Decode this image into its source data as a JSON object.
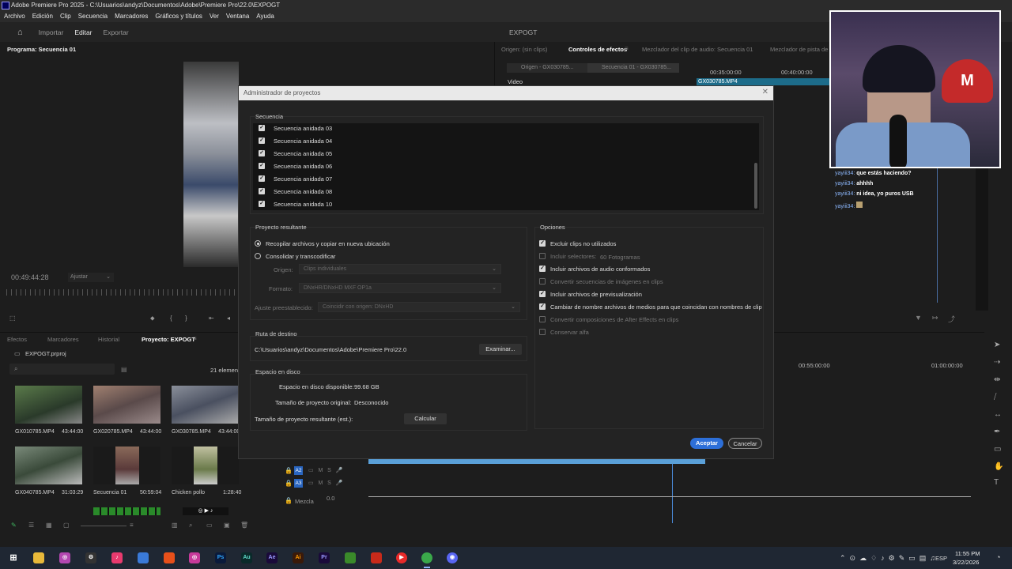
{
  "window": {
    "title": "Adobe Premiere Pro 2025 - C:\\Usuarios\\andyz\\Documentos\\Adobe\\Premiere Pro\\22.0\\EXPOGT"
  },
  "menu": [
    "Archivo",
    "Edición",
    "Clip",
    "Secuencia",
    "Marcadores",
    "Gráficos y títulos",
    "Ver",
    "Ventana",
    "Ayuda"
  ],
  "workspace": {
    "tabs": [
      "Importar",
      "Editar",
      "Exportar"
    ],
    "active": "Editar",
    "project_name": "EXPOGT"
  },
  "program_monitor": {
    "title": "Programa: Secuencia 01",
    "timecode": "00:49:44:28",
    "fit": "Ajustar"
  },
  "effects_panel": {
    "tabs": [
      "Origen: (sin clips)",
      "Controles de efectos",
      "Mezclador del clip de audio: Secuencia 01",
      "Mezclador de pista de"
    ],
    "active_tab": "Controles de efectos",
    "source_label": "Origen - GX030785...",
    "sequence_label": "Secuencia 01 - GX030785...",
    "video_label": "Video",
    "times": [
      "00:35:00:00",
      "00:40:00:00"
    ],
    "clip_label": "GX030785.MP4"
  },
  "project_panel": {
    "tabs": [
      "Efectos",
      "Marcadores",
      "Historial",
      "Proyecto: EXPOGT"
    ],
    "active_tab": "Proyecto: EXPOGT",
    "file": "EXPOGT.prproj",
    "count": "21 element",
    "items": [
      {
        "name": "GX010785.MP4",
        "duration": "43:44:00",
        "color": "#3a5a2a"
      },
      {
        "name": "GX020785.MP4",
        "duration": "43:44:00",
        "color": "#7a5a4a"
      },
      {
        "name": "GX030785.MP4",
        "duration": "43:44:00",
        "color": "#6a6f7a"
      },
      {
        "name": "GX040785.MP4",
        "duration": "31:03:29",
        "color": "#5a6a5a"
      },
      {
        "name": "Secuencia 01",
        "duration": "50:59:04",
        "color": "#8a5a5a"
      },
      {
        "name": "Chicken pollo",
        "duration": "1:28:40",
        "color": "#9aa07a"
      }
    ]
  },
  "timeline": {
    "times": [
      "00:55:00:00",
      "01:00:00:00"
    ],
    "tracks": [
      "A2",
      "A3"
    ],
    "mix_label": "Mezcla",
    "mix_value": "0.0"
  },
  "dialog": {
    "title": "Administrador de proyectos",
    "sequence_group": "Secuencia",
    "sequences": [
      {
        "label": "Secuencia anidada 03",
        "checked": true
      },
      {
        "label": "Secuencia anidada 04",
        "checked": true
      },
      {
        "label": "Secuencia anidada 05",
        "checked": true
      },
      {
        "label": "Secuencia anidada 06",
        "checked": true
      },
      {
        "label": "Secuencia anidada 07",
        "checked": true
      },
      {
        "label": "Secuencia anidada 08",
        "checked": true
      },
      {
        "label": "Secuencia anidada 10",
        "checked": true
      }
    ],
    "result_group": "Proyecto resultante",
    "radio_collect": "Recopilar archivos y copiar en nueva ubicación",
    "radio_consolidate": "Consolidar y transcodificar",
    "origin_label": "Origen:",
    "origin_value": "Clips individuales",
    "format_label": "Formato:",
    "format_value": "DNxHR/DNxHD MXF OP1a",
    "preset_label": "Ajuste preestablecido:",
    "preset_value": "Coincidir con origen: DNxHD",
    "options_group": "Opciones",
    "options": [
      {
        "label": "Excluir clips no utilizados",
        "checked": true,
        "enabled": true
      },
      {
        "label": "Incluir selectores:",
        "checked": false,
        "enabled": false,
        "extra": "60 Fotogramas"
      },
      {
        "label": "Incluir archivos de audio conformados",
        "checked": true,
        "enabled": true
      },
      {
        "label": "Convertir secuencias de imágenes en clips",
        "checked": false,
        "enabled": false
      },
      {
        "label": "Incluir archivos de previsualización",
        "checked": true,
        "enabled": true
      },
      {
        "label": "Cambiar de nombre archivos de medios para que coincidan con nombres de clip",
        "checked": true,
        "enabled": true
      },
      {
        "label": "Convertir composiciones de After Effects en clips",
        "checked": false,
        "enabled": false
      },
      {
        "label": "Conservar alfa",
        "checked": false,
        "enabled": false
      }
    ],
    "dest_group": "Ruta de destino",
    "dest_path": "C:\\Usuarios\\andyz\\Documentos\\Adobe\\Premiere Pro\\22.0",
    "browse": "Examinar...",
    "disk_group": "Espacio en disco",
    "disk_available_label": "Espacio en disco disponible:",
    "disk_available": "99.68 GB",
    "original_size_label": "Tamaño de proyecto original:",
    "original_size": "Desconocido",
    "result_size_label": "Tamaño de proyecto resultante (est.):",
    "calc": "Calcular",
    "accept": "Aceptar",
    "cancel": "Cancelar"
  },
  "chat": [
    {
      "user": "yayiii34:",
      "msg": "que estás haciendo?"
    },
    {
      "user": "yayiii34:",
      "msg": "ahhhh"
    },
    {
      "user": "yayiii34:",
      "msg": "ni idea, yo puros USB"
    },
    {
      "user": "yayiii34:",
      "msg": ""
    }
  ],
  "taskbar": {
    "apps": [
      "Ps",
      "Au",
      "Ae",
      "Ai",
      "Pr"
    ],
    "lang": "ESP",
    "time": "11:55 PM",
    "date": "3/22/2026"
  },
  "colors": {
    "accent": "#2d6fd8",
    "audio_track": "#2a66c0",
    "panel_bg": "#1d1d1d"
  }
}
